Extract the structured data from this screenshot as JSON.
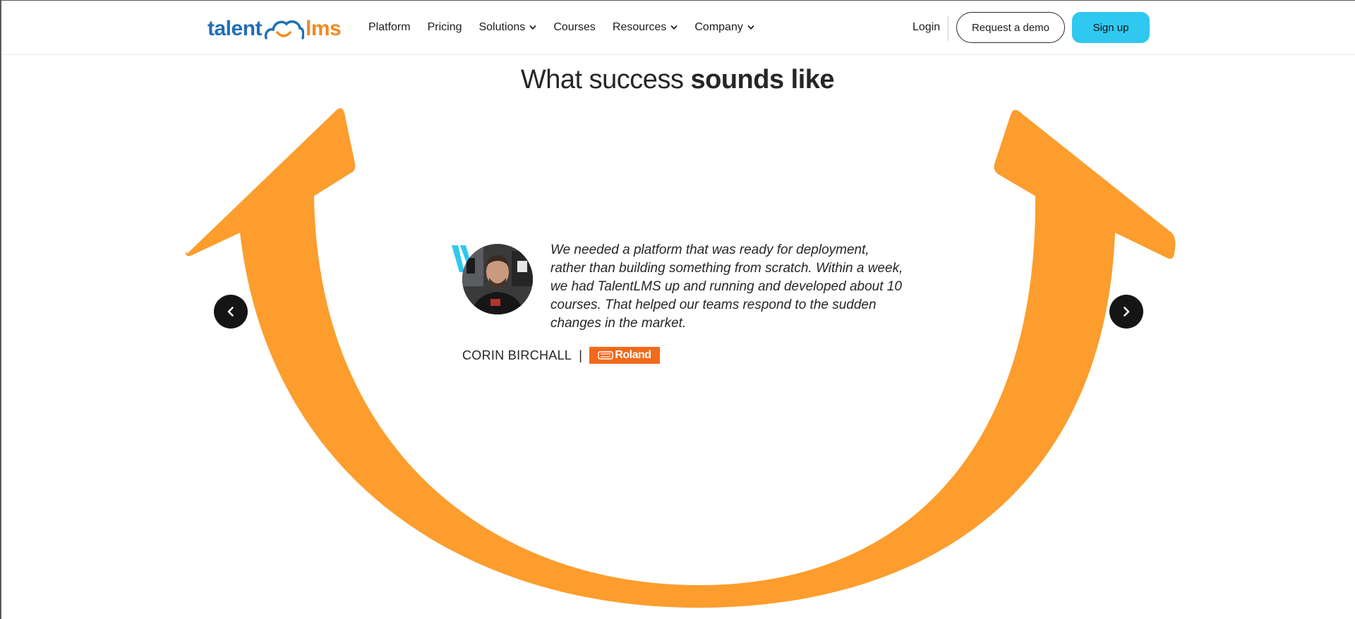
{
  "brand": {
    "logo_left": "talent",
    "logo_right": "lms",
    "colors": {
      "blue": "#1f6fb8",
      "orange": "#f28a21",
      "accent": "#2fc8ef",
      "arrow": "#fc9d2d"
    }
  },
  "nav": {
    "items": [
      {
        "label": "Platform",
        "dropdown": false
      },
      {
        "label": "Pricing",
        "dropdown": false
      },
      {
        "label": "Solutions",
        "dropdown": true
      },
      {
        "label": "Courses",
        "dropdown": false
      },
      {
        "label": "Resources",
        "dropdown": true
      },
      {
        "label": "Company",
        "dropdown": true
      }
    ],
    "login": "Login",
    "request_demo": "Request a demo",
    "signup": "Sign up"
  },
  "section": {
    "title_regular": "What success ",
    "title_bold": "sounds like"
  },
  "testimonial": {
    "quote": "We needed a platform that was ready for deployment, rather than building something from scratch. Within a week, we had TalentLMS up and running and developed about 10 courses. That helped our teams respond to the sudden changes in the market.",
    "author": "CORIN BIRCHALL",
    "separator": "|",
    "company": "Roland"
  },
  "icons": {
    "prev": "chevron-left-icon",
    "next": "chevron-right-icon",
    "quote": "quote-mark-icon"
  }
}
